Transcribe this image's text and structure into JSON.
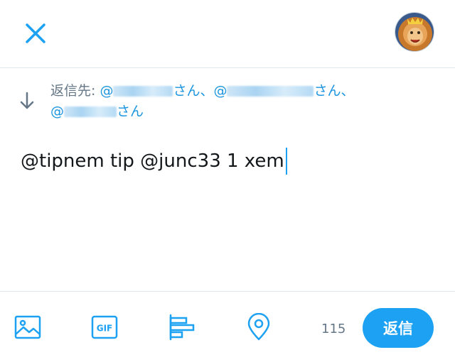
{
  "header": {
    "close_icon": "close-icon",
    "avatar_icon": "lion-avatar"
  },
  "reply": {
    "prefix": "返信先: ",
    "mention_1_start": "@",
    "mention_1_end": "さん、",
    "mention_2_start": "@",
    "mention_2_end": "さん、",
    "mention_3_start": "@",
    "mention_3_end": "さん"
  },
  "compose": {
    "text": "@tipnem tip @junc33 1 xem"
  },
  "toolbar": {
    "char_count": "115",
    "reply_label": "返信",
    "icons": [
      "image-icon",
      "gif-icon",
      "poll-icon",
      "location-icon"
    ],
    "gif_text": "GIF"
  },
  "colors": {
    "accent": "#1da1f2",
    "mention": "#1b95e0",
    "secondary_text": "#657786"
  }
}
